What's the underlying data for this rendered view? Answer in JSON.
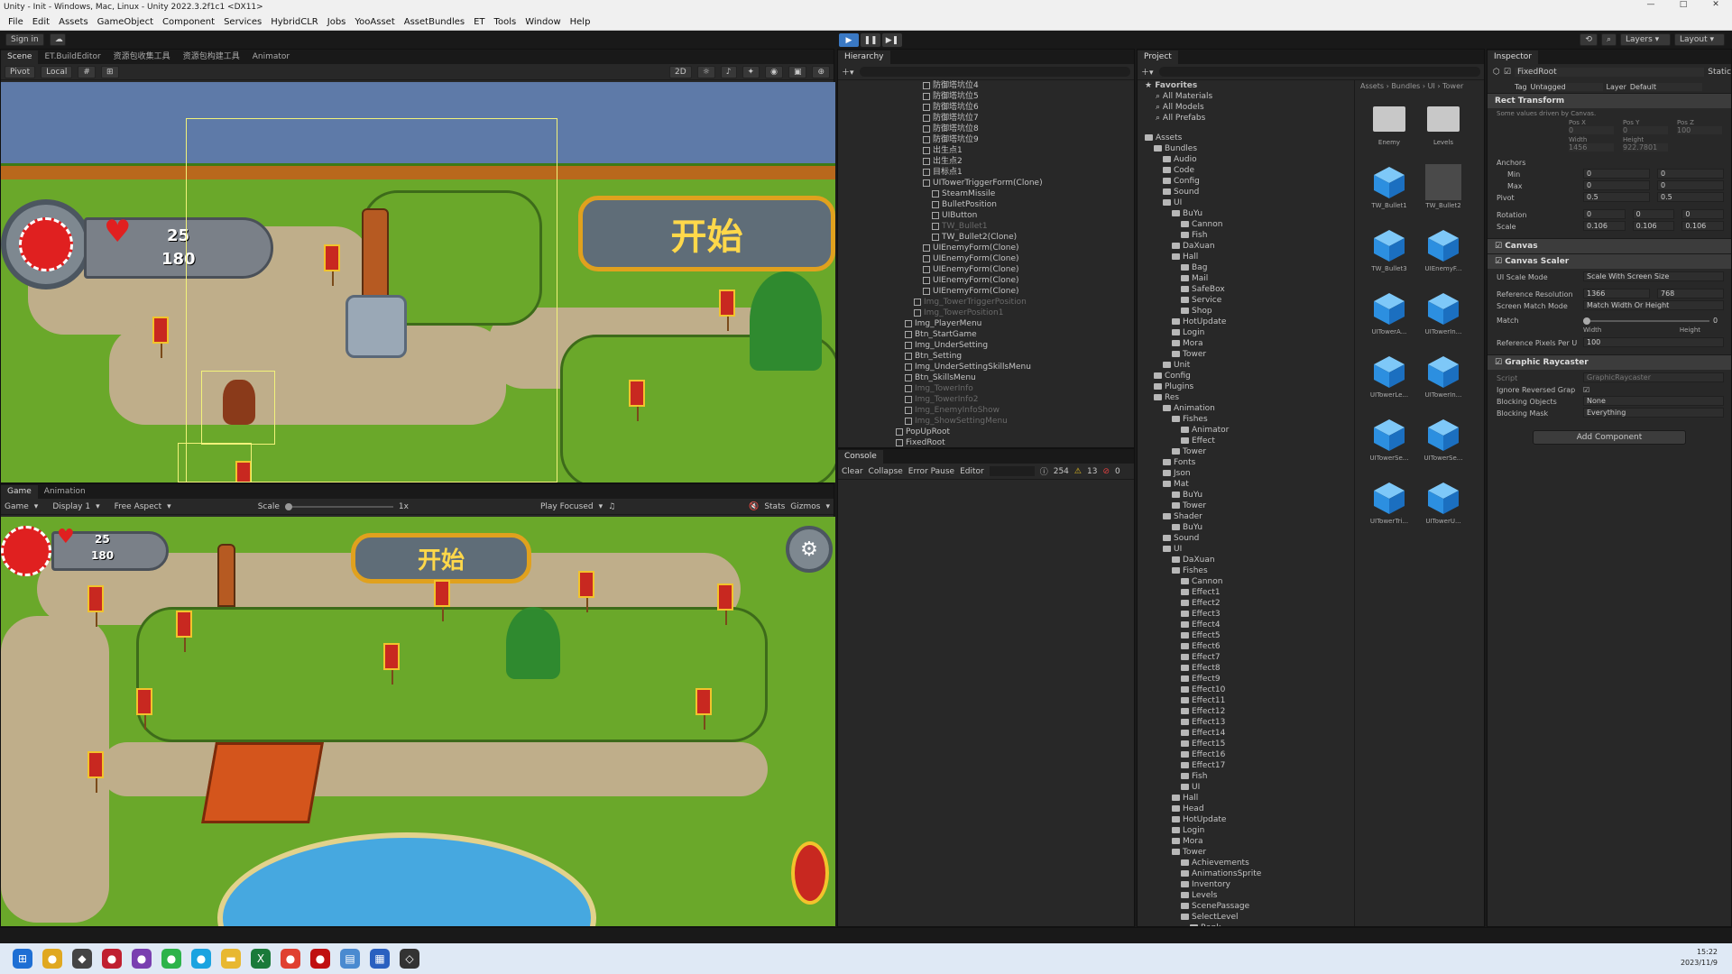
{
  "window": {
    "title": "Unity - Init - Windows, Mac, Linux - Unity 2022.3.2f1c1 <DX11>",
    "controls": [
      "—",
      "□",
      "✕"
    ]
  },
  "menu": [
    "File",
    "Edit",
    "Assets",
    "GameObject",
    "Component",
    "Services",
    "HybridCLR",
    "Jobs",
    "YooAsset",
    "AssetBundles",
    "ET",
    "Tools",
    "Window",
    "Help"
  ],
  "toolbar": {
    "sign_in": "Sign in",
    "layers": "Layers",
    "layout": "Layout"
  },
  "scene_tabs": [
    "Scene",
    "ET.BuildEditor",
    "资源包收集工具",
    "资源包构建工具",
    "Animator"
  ],
  "scene_toolbar": {
    "pivot": "Pivot",
    "local": "Local",
    "mode_2d": "2D"
  },
  "game_tabs": [
    "Game",
    "Animation"
  ],
  "game_toolbar": {
    "game": "Game",
    "display": "Display 1",
    "aspect": "Free Aspect",
    "scale_label": "Scale",
    "scale_value": "1x",
    "play_focused": "Play Focused",
    "stats": "Stats",
    "gizmos": "Gizmos"
  },
  "game_ui": {
    "gold": "25",
    "wave": "180",
    "start_label": "开始"
  },
  "hierarchy": {
    "title": "Hierarchy",
    "items": [
      {
        "label": "防御塔坑位4",
        "dim": false
      },
      {
        "label": "防御塔坑位5",
        "dim": false
      },
      {
        "label": "防御塔坑位6",
        "dim": false
      },
      {
        "label": "防御塔坑位7",
        "dim": false
      },
      {
        "label": "防御塔坑位8",
        "dim": false
      },
      {
        "label": "防御塔坑位9",
        "dim": false
      },
      {
        "label": "出生点1",
        "dim": false
      },
      {
        "label": "出生点2",
        "dim": false
      },
      {
        "label": "目标点1",
        "dim": false
      },
      {
        "label": "UITowerTriggerForm(Clone)",
        "dim": false
      },
      {
        "label": "SteamMissile",
        "dim": false
      },
      {
        "label": "BulletPosition",
        "dim": false
      },
      {
        "label": "UIButton",
        "dim": false
      },
      {
        "label": "TW_Bullet1",
        "dim": true
      },
      {
        "label": "TW_Bullet2(Clone)",
        "dim": false
      },
      {
        "label": "UIEnemyForm(Clone)",
        "dim": false
      },
      {
        "label": "UIEnemyForm(Clone)",
        "dim": false
      },
      {
        "label": "UIEnemyForm(Clone)",
        "dim": false
      },
      {
        "label": "UIEnemyForm(Clone)",
        "dim": false
      },
      {
        "label": "UIEnemyForm(Clone)",
        "dim": false
      },
      {
        "label": "Img_TowerTriggerPosition",
        "dim": true
      },
      {
        "label": "Img_TowerPosition1",
        "dim": true
      },
      {
        "label": "Img_PlayerMenu",
        "dim": false
      },
      {
        "label": "Btn_StartGame",
        "dim": false
      },
      {
        "label": "Img_UnderSetting",
        "dim": false
      },
      {
        "label": "Btn_Setting",
        "dim": false
      },
      {
        "label": "Img_UnderSettingSkillsMenu",
        "dim": false
      },
      {
        "label": "Btn_SkillsMenu",
        "dim": false
      },
      {
        "label": "Img_TowerInfo",
        "dim": true
      },
      {
        "label": "Img_TowerInfo2",
        "dim": true
      },
      {
        "label": "Img_EnemyInfoShow",
        "dim": true
      },
      {
        "label": "Img_ShowSettingMenu",
        "dim": true
      },
      {
        "label": "PopUpRoot",
        "dim": false
      },
      {
        "label": "FixedRoot",
        "dim": false
      }
    ]
  },
  "console": {
    "title": "Console",
    "clear": "Clear",
    "collapse": "Collapse",
    "error_pause": "Error Pause",
    "editor": "Editor",
    "logs": "254",
    "warnings": "13",
    "errors": "0"
  },
  "project": {
    "title": "Project",
    "favorites_label": "Favorites",
    "favorites": [
      "All Materials",
      "All Models",
      "All Prefabs"
    ],
    "breadcrumb": "Assets › Bundles › UI › Tower",
    "tree": [
      {
        "label": "Assets",
        "lvl": 0
      },
      {
        "label": "Bundles",
        "lvl": 1
      },
      {
        "label": "Audio",
        "lvl": 2
      },
      {
        "label": "Code",
        "lvl": 2
      },
      {
        "label": "Config",
        "lvl": 2
      },
      {
        "label": "Sound",
        "lvl": 2
      },
      {
        "label": "UI",
        "lvl": 2
      },
      {
        "label": "BuYu",
        "lvl": 3
      },
      {
        "label": "Cannon",
        "lvl": 4
      },
      {
        "label": "Fish",
        "lvl": 4
      },
      {
        "label": "DaXuan",
        "lvl": 3
      },
      {
        "label": "Hall",
        "lvl": 3
      },
      {
        "label": "Bag",
        "lvl": 4
      },
      {
        "label": "Mail",
        "lvl": 4
      },
      {
        "label": "SafeBox",
        "lvl": 4
      },
      {
        "label": "Service",
        "lvl": 4
      },
      {
        "label": "Shop",
        "lvl": 4
      },
      {
        "label": "HotUpdate",
        "lvl": 3
      },
      {
        "label": "Login",
        "lvl": 3
      },
      {
        "label": "Mora",
        "lvl": 3
      },
      {
        "label": "Tower",
        "lvl": 3
      },
      {
        "label": "Unit",
        "lvl": 2
      },
      {
        "label": "Config",
        "lvl": 1
      },
      {
        "label": "Plugins",
        "lvl": 1
      },
      {
        "label": "Res",
        "lvl": 1
      },
      {
        "label": "Animation",
        "lvl": 2
      },
      {
        "label": "Fishes",
        "lvl": 3
      },
      {
        "label": "Animator",
        "lvl": 4
      },
      {
        "label": "Effect",
        "lvl": 4
      },
      {
        "label": "Tower",
        "lvl": 3
      },
      {
        "label": "Fonts",
        "lvl": 2
      },
      {
        "label": "Json",
        "lvl": 2
      },
      {
        "label": "Mat",
        "lvl": 2
      },
      {
        "label": "BuYu",
        "lvl": 3
      },
      {
        "label": "Tower",
        "lvl": 3
      },
      {
        "label": "Shader",
        "lvl": 2
      },
      {
        "label": "BuYu",
        "lvl": 3
      },
      {
        "label": "Sound",
        "lvl": 2
      },
      {
        "label": "UI",
        "lvl": 2
      },
      {
        "label": "DaXuan",
        "lvl": 3
      },
      {
        "label": "Fishes",
        "lvl": 3
      },
      {
        "label": "Cannon",
        "lvl": 4
      },
      {
        "label": "Effect1",
        "lvl": 4
      },
      {
        "label": "Effect2",
        "lvl": 4
      },
      {
        "label": "Effect3",
        "lvl": 4
      },
      {
        "label": "Effect4",
        "lvl": 4
      },
      {
        "label": "Effect5",
        "lvl": 4
      },
      {
        "label": "Effect6",
        "lvl": 4
      },
      {
        "label": "Effect7",
        "lvl": 4
      },
      {
        "label": "Effect8",
        "lvl": 4
      },
      {
        "label": "Effect9",
        "lvl": 4
      },
      {
        "label": "Effect10",
        "lvl": 4
      },
      {
        "label": "Effect11",
        "lvl": 4
      },
      {
        "label": "Effect12",
        "lvl": 4
      },
      {
        "label": "Effect13",
        "lvl": 4
      },
      {
        "label": "Effect14",
        "lvl": 4
      },
      {
        "label": "Effect15",
        "lvl": 4
      },
      {
        "label": "Effect16",
        "lvl": 4
      },
      {
        "label": "Effect17",
        "lvl": 4
      },
      {
        "label": "Fish",
        "lvl": 4
      },
      {
        "label": "UI",
        "lvl": 4
      },
      {
        "label": "Hall",
        "lvl": 3
      },
      {
        "label": "Head",
        "lvl": 3
      },
      {
        "label": "HotUpdate",
        "lvl": 3
      },
      {
        "label": "Login",
        "lvl": 3
      },
      {
        "label": "Mora",
        "lvl": 3
      },
      {
        "label": "Tower",
        "lvl": 3
      },
      {
        "label": "Achievements",
        "lvl": 4
      },
      {
        "label": "AnimationsSprite",
        "lvl": 4
      },
      {
        "label": "Inventory",
        "lvl": 4
      },
      {
        "label": "Levels",
        "lvl": 4
      },
      {
        "label": "ScenePassage",
        "lvl": 4
      },
      {
        "label": "SelectLevel",
        "lvl": 4
      },
      {
        "label": "Rank",
        "lvl": 5
      }
    ],
    "assets": [
      {
        "name": "Enemy",
        "kind": "folder"
      },
      {
        "name": "Levels",
        "kind": "folder"
      },
      {
        "name": "TW_Bullet1",
        "kind": "prefab"
      },
      {
        "name": "TW_Bullet2",
        "kind": "sprite"
      },
      {
        "name": "TW_Bullet3",
        "kind": "prefab"
      },
      {
        "name": "UIEnemyF...",
        "kind": "prefab"
      },
      {
        "name": "UITowerA...",
        "kind": "prefab"
      },
      {
        "name": "UITowerIn...",
        "kind": "prefab"
      },
      {
        "name": "UITowerLe...",
        "kind": "prefab"
      },
      {
        "name": "UITowerIn...",
        "kind": "prefab"
      },
      {
        "name": "UITowerSe...",
        "kind": "prefab"
      },
      {
        "name": "UITowerSe...",
        "kind": "prefab"
      },
      {
        "name": "UITowerTri...",
        "kind": "prefab"
      },
      {
        "name": "UITowerU...",
        "kind": "prefab"
      }
    ]
  },
  "inspector": {
    "title": "Inspector",
    "object_name": "FixedRoot",
    "static": "Static",
    "tag_label": "Tag",
    "tag": "Untagged",
    "layer_label": "Layer",
    "layer": "Default",
    "rect_transform": {
      "title": "Rect Transform",
      "note": "Some values driven by Canvas.",
      "pos_labels": [
        "Pos X",
        "Pos Y",
        "Pos Z"
      ],
      "pos_values": [
        "0",
        "0",
        "100"
      ],
      "size_labels": [
        "Width",
        "Height"
      ],
      "size_values": [
        "1456",
        "922.7801"
      ],
      "anchors": "Anchors",
      "min": "Min",
      "min_values": [
        "0",
        "0"
      ],
      "max": "Max",
      "max_values": [
        "0",
        "0"
      ],
      "pivot": "Pivot",
      "pivot_values": [
        "0.5",
        "0.5"
      ],
      "rotation": "Rotation",
      "rotation_values": [
        "0",
        "0",
        "0"
      ],
      "scale": "Scale",
      "scale_values": [
        "0.106",
        "0.106",
        "0.106"
      ]
    },
    "canvas": "Canvas",
    "canvas_scaler": {
      "title": "Canvas Scaler",
      "ui_scale_mode_label": "UI Scale Mode",
      "ui_scale_mode": "Scale With Screen Size",
      "ref_res_label": "Reference Resolution",
      "ref_x": "1366",
      "ref_y": "768",
      "match_mode_label": "Screen Match Mode",
      "match_mode": "Match Width Or Height",
      "match_label": "Match",
      "match_value": "0",
      "match_fraction": 0,
      "match_width": "Width",
      "match_height": "Height",
      "ppu_label": "Reference Pixels Per U",
      "ppu": "100"
    },
    "graphic_raycaster": {
      "title": "Graphic Raycaster",
      "script_label": "Script",
      "script": "GraphicRaycaster",
      "ignore_label": "Ignore Reversed Grap",
      "blocking_objects_label": "Blocking Objects",
      "blocking_objects": "None",
      "blocking_mask_label": "Blocking Mask",
      "blocking_mask": "Everything"
    },
    "add_component": "Add Component"
  },
  "taskbar": {
    "time": "15:22",
    "date": "2023/11/9"
  }
}
